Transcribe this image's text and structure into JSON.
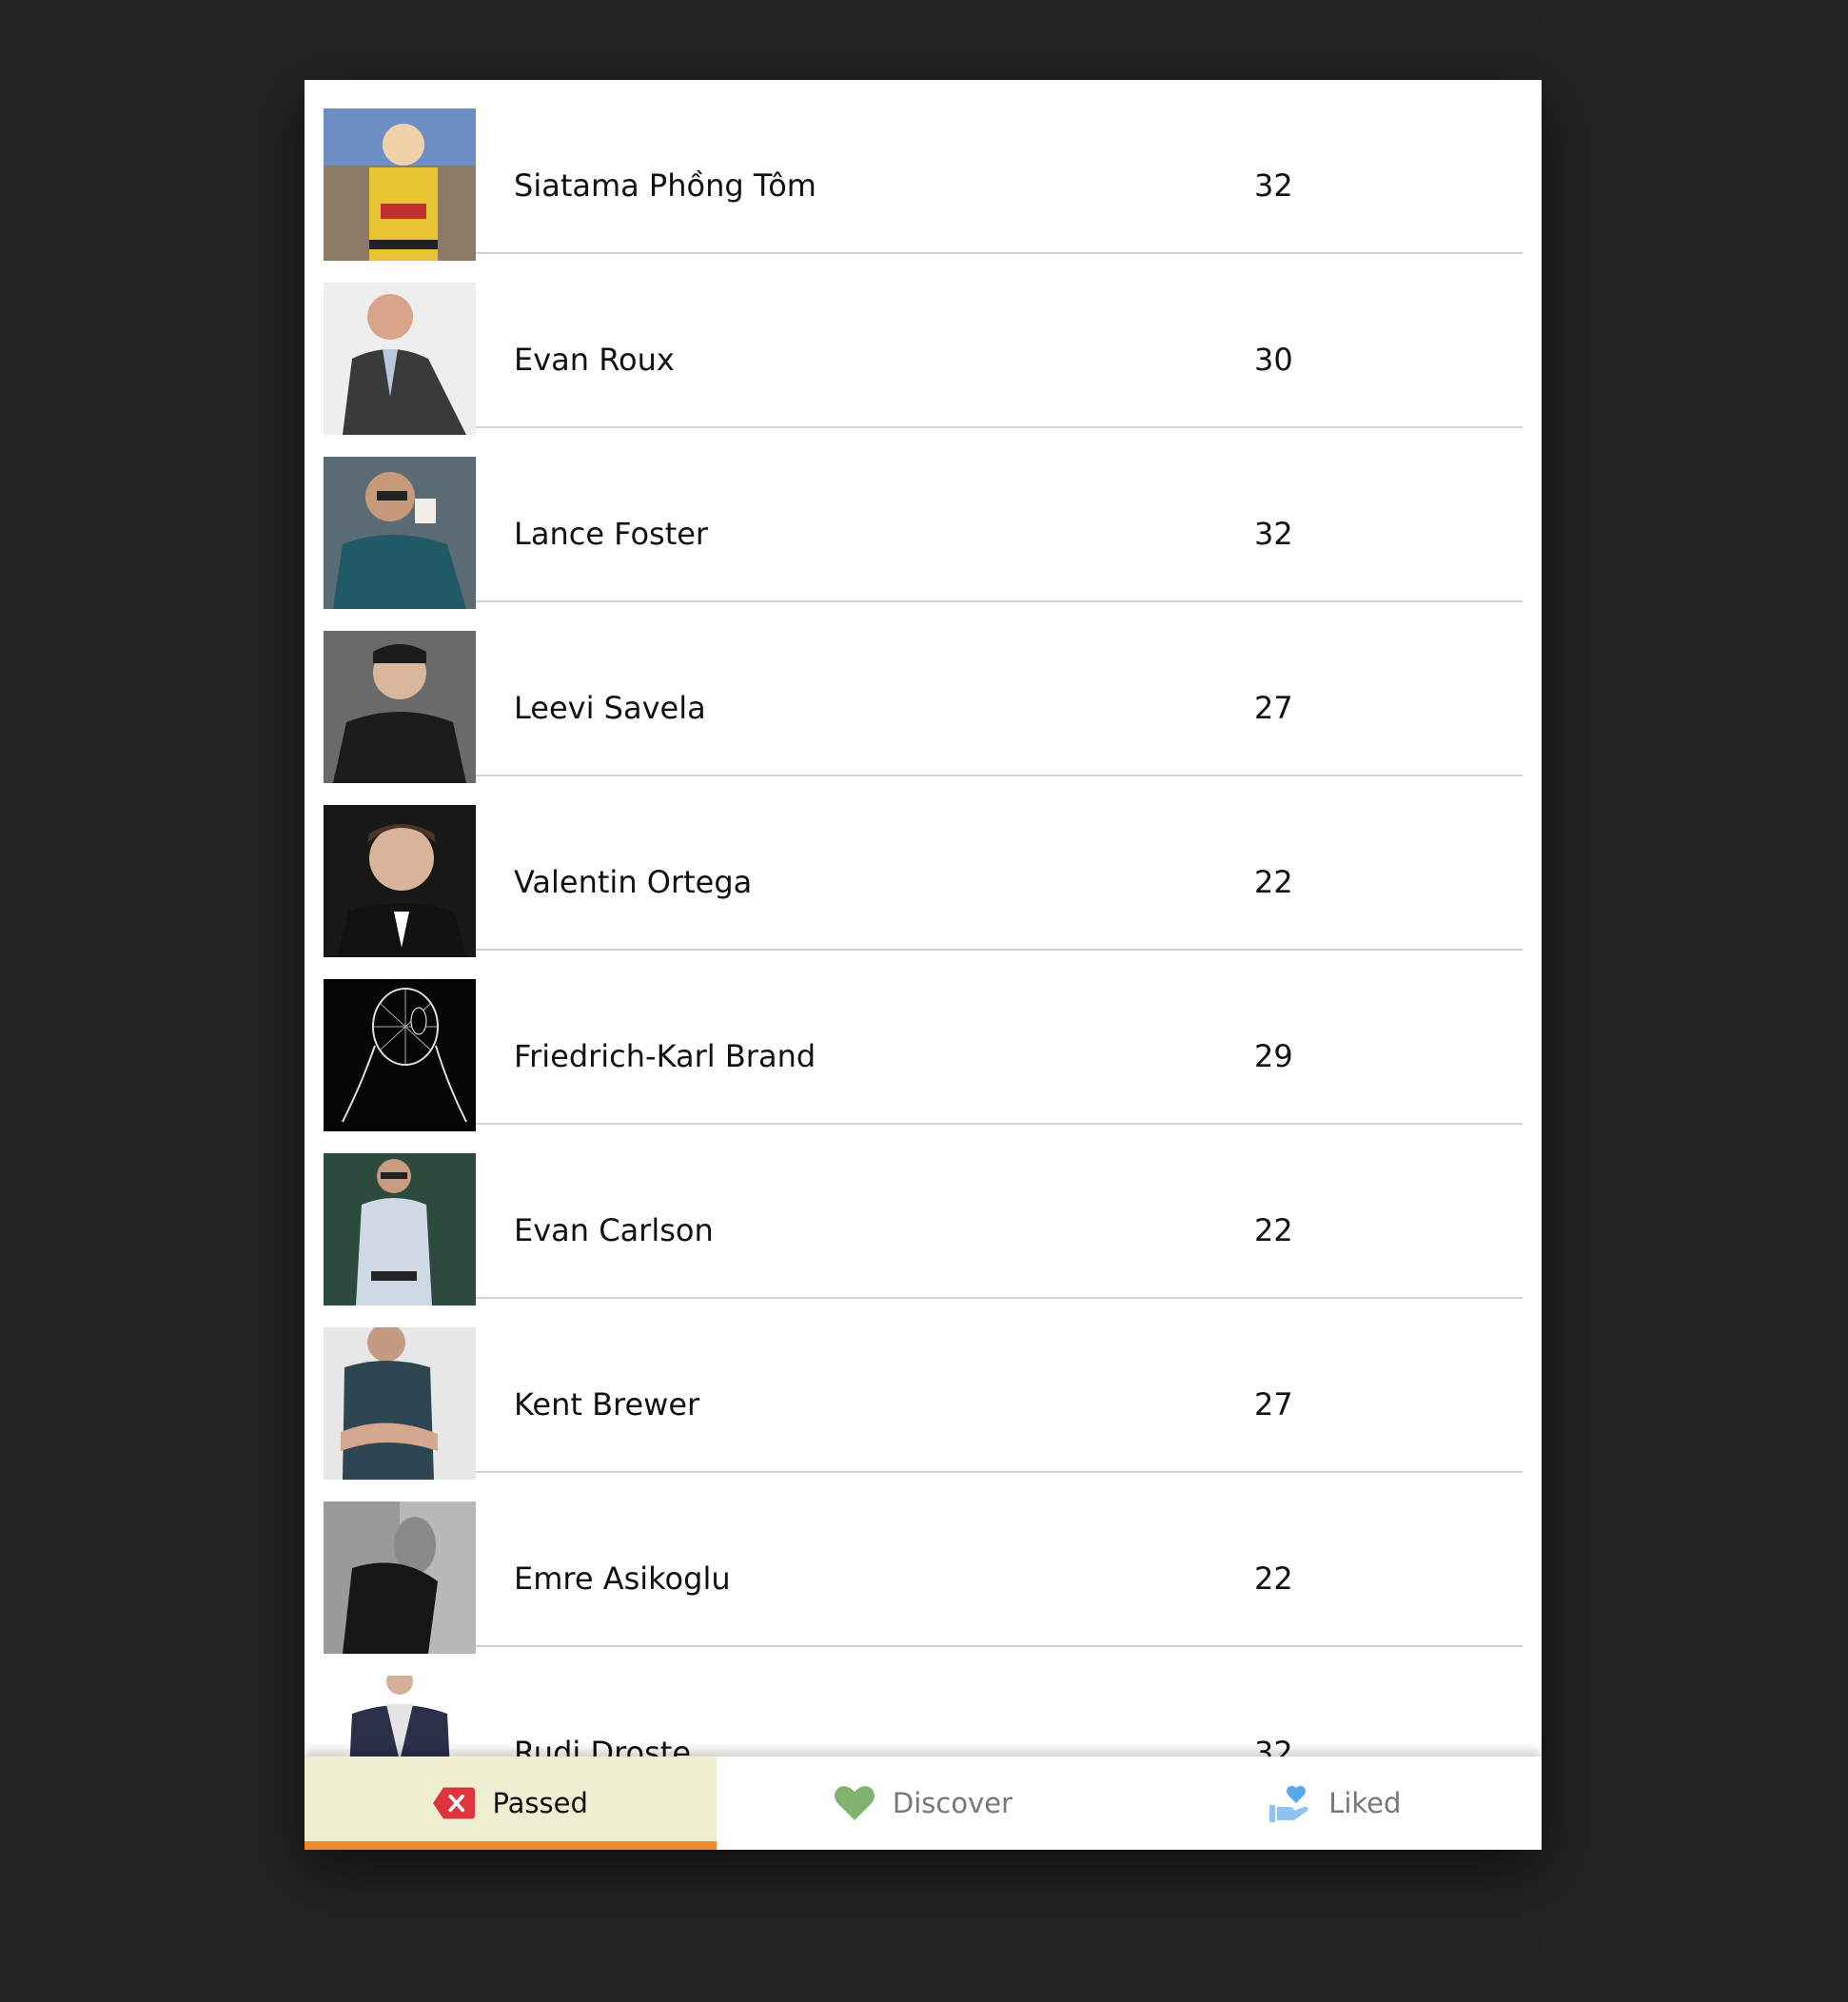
{
  "contacts": [
    {
      "name": "Siatama Phồng Tôm",
      "age": "32",
      "avatar": "anime-character-photo"
    },
    {
      "name": "Evan Roux",
      "age": "30",
      "avatar": "man-in-suit-photo"
    },
    {
      "name": "Lance Foster",
      "age": "32",
      "avatar": "man-drinking-coffee-photo"
    },
    {
      "name": "Leevi Savela",
      "age": "27",
      "avatar": "man-dark-shirt-photo"
    },
    {
      "name": "Valentin Ortega",
      "age": "22",
      "avatar": "man-portrait-photo"
    },
    {
      "name": "Friedrich-Karl Brand",
      "age": "29",
      "avatar": "wireframe-head-art"
    },
    {
      "name": "Evan Carlson",
      "age": "22",
      "avatar": "man-with-sunglasses-photo"
    },
    {
      "name": "Kent Brewer",
      "age": "27",
      "avatar": "man-arms-crossed-photo"
    },
    {
      "name": "Emre Asikoglu",
      "age": "22",
      "avatar": "man-profile-bw-photo"
    },
    {
      "name": "Rudi Droste",
      "age": "32",
      "avatar": "man-jacket-photo"
    }
  ],
  "tabs": {
    "passed": {
      "label": "Passed",
      "icon": "close-icon",
      "color": "#e0343c",
      "active": true
    },
    "discover": {
      "label": "Discover",
      "icon": "heart-icon",
      "color": "#7fb36f",
      "active": false
    },
    "liked": {
      "label": "Liked",
      "icon": "heart-hand-icon",
      "color": "#5aa8e8",
      "active": false
    }
  },
  "colors": {
    "background": "#232323",
    "active_tab_bg": "#efeed0",
    "active_tab_indicator": "#f08a2c"
  }
}
